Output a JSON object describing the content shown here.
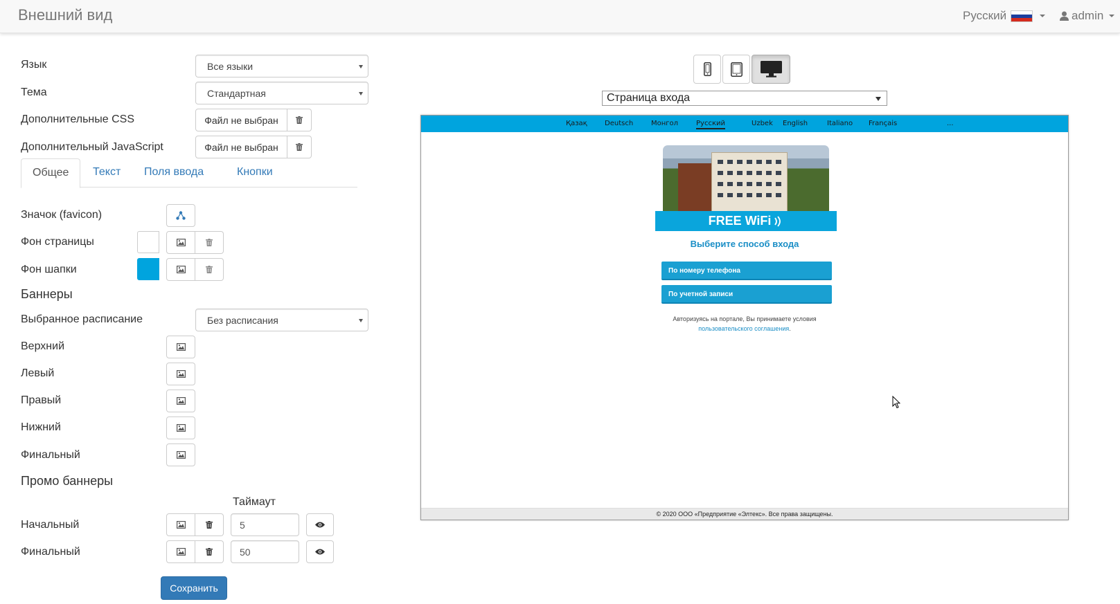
{
  "header": {
    "title": "Внешний вид",
    "language_label": "Русский",
    "user_label": "admin"
  },
  "settings": {
    "language_label": "Язык",
    "language_value": "Все языки",
    "theme_label": "Тема",
    "theme_value": "Стандартная",
    "css_label": "Дополнительные CSS",
    "css_file": "Файл не выбран",
    "js_label": "Дополнительный JavaScript",
    "js_file": "Файл не выбран"
  },
  "tabs": [
    {
      "label": "Общее",
      "active": true
    },
    {
      "label": "Текст",
      "active": false
    },
    {
      "label": "Поля ввода",
      "active": false
    },
    {
      "label": "Кнопки",
      "active": false
    }
  ],
  "general": {
    "favicon_label": "Значок (favicon)",
    "page_bg_label": "Фон страницы",
    "page_bg_color": "#ffffff",
    "header_bg_label": "Фон шапки",
    "header_bg_color": "#00a4de"
  },
  "banners": {
    "heading": "Баннеры",
    "schedule_label": "Выбранное расписание",
    "schedule_value": "Без расписания",
    "top_label": "Верхний",
    "left_label": "Левый",
    "right_label": "Правый",
    "bottom_label": "Нижний",
    "final_label": "Финальный"
  },
  "promo": {
    "heading": "Промо баннеры",
    "timeout_header": "Таймаут",
    "initial_label": "Начальный",
    "initial_timeout": "5",
    "final_label": "Финальный",
    "final_timeout": "50"
  },
  "save_label": "Сохранить",
  "preview": {
    "page_select": "Страница входа",
    "languages": [
      "Қазақ",
      "Deutsch",
      "Монгол",
      "Русский",
      "Uzbek",
      "English",
      "Italiano",
      "Français",
      "..."
    ],
    "current_language": "Русский",
    "wifi_text": "FREE WiFi",
    "choose_text": "Выберите способ входа",
    "phone_button": "По номеру телефона",
    "account_button": "По учетной записи",
    "terms_line1": "Авторизуясь на портале, Вы принимаете условия",
    "terms_link": "пользовательского соглашения",
    "terms_end": ".",
    "footer": "© 2020 ООО «Предприятие «Элтекс». Все права защищены.",
    "header_color": "#00a4de"
  }
}
